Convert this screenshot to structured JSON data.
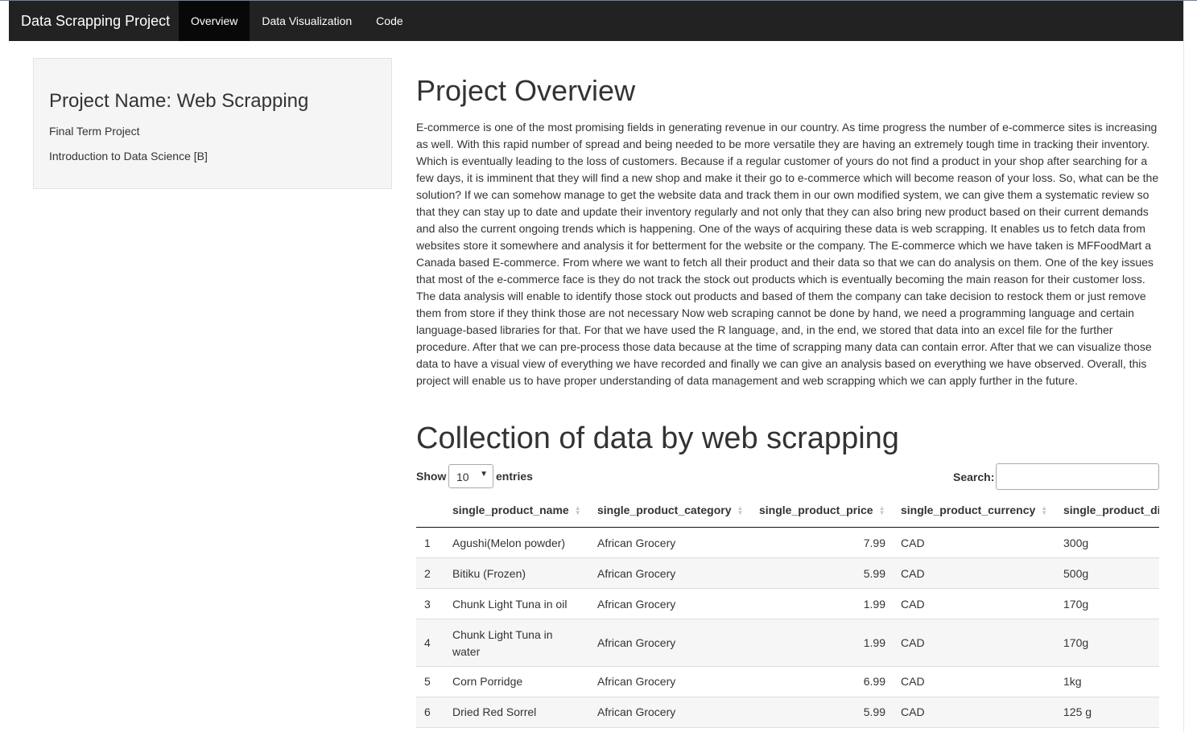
{
  "navbar": {
    "brand": "Data Scrapping Project",
    "items": [
      {
        "label": "Overview",
        "active": true
      },
      {
        "label": "Data Visualization",
        "active": false
      },
      {
        "label": "Code",
        "active": false
      }
    ]
  },
  "sidebar": {
    "title": "Project Name: Web Scrapping",
    "line1": "Final Term Project",
    "line2": "Introduction to Data Science [B]"
  },
  "overview": {
    "heading": "Project Overview",
    "paragraph": "E-commerce is one of the most promising fields in generating revenue in our country. As time progress the number of e-commerce sites is increasing as well. With this rapid number of spread and being needed to be more versatile they are having an extremely tough time in tracking their inventory. Which is eventually leading to the loss of customers. Because if a regular customer of yours do not find a product in your shop after searching for a few days, it is imminent that they will find a new shop and make it their go to e-commerce which will become reason of your loss. So, what can be the solution? If we can somehow manage to get the website data and track them in our own modified system, we can give them a systematic review so that they can stay up to date and update their inventory regularly and not only that they can also bring new product based on their current demands and also the current ongoing trends which is happening. One of the ways of acquiring these data is web scrapping. It enables us to fetch data from websites store it somewhere and analysis it for betterment for the website or the company. The E-commerce which we have taken is MFFoodMart a Canada based E-commerce. From where we want to fetch all their product and their data so that we can do analysis on them. One of the key issues that most of the e-commerce face is they do not track the stock out products which is eventually becoming the main reason for their customer loss. The data analysis will enable to identify those stock out products and based of them the company can take decision to restock them or just remove them from store if they think those are not necessary Now web scraping cannot be done by hand, we need a programming language and certain language-based libraries for that. For that we have used the R language, and, in the end, we stored that data into an excel file for the further procedure. After that we can pre-process those data because at the time of scrapping many data can contain error. After that we can visualize those data to have a visual view of everything we have recorded and finally we can give an analysis based on everything we have observed. Overall, this project will enable us to have proper understanding of data management and web scrapping which we can apply further in the future."
  },
  "collection": {
    "heading": "Collection of data by web scrapping",
    "show_label": "Show",
    "entries_value": "10",
    "entries_label": "entries",
    "search_label": "Search:",
    "search_value": ""
  },
  "table": {
    "columns": [
      "",
      "single_product_name",
      "single_product_category",
      "single_product_price",
      "single_product_currency",
      "single_product_di"
    ],
    "rows": [
      [
        "1",
        "Agushi(Melon powder)",
        "African Grocery",
        "7.99",
        "CAD",
        "300g"
      ],
      [
        "2",
        "Bitiku (Frozen)",
        "African Grocery",
        "5.99",
        "CAD",
        "500g"
      ],
      [
        "3",
        "Chunk Light Tuna in oil",
        "African Grocery",
        "1.99",
        "CAD",
        "170g"
      ],
      [
        "4",
        "Chunk Light Tuna in water",
        "African Grocery",
        "1.99",
        "CAD",
        "170g"
      ],
      [
        "5",
        "Corn Porridge",
        "African Grocery",
        "6.99",
        "CAD",
        "1kg"
      ],
      [
        "6",
        "Dried Red Sorrel",
        "African Grocery",
        "5.99",
        "CAD",
        "125 g"
      ]
    ]
  }
}
